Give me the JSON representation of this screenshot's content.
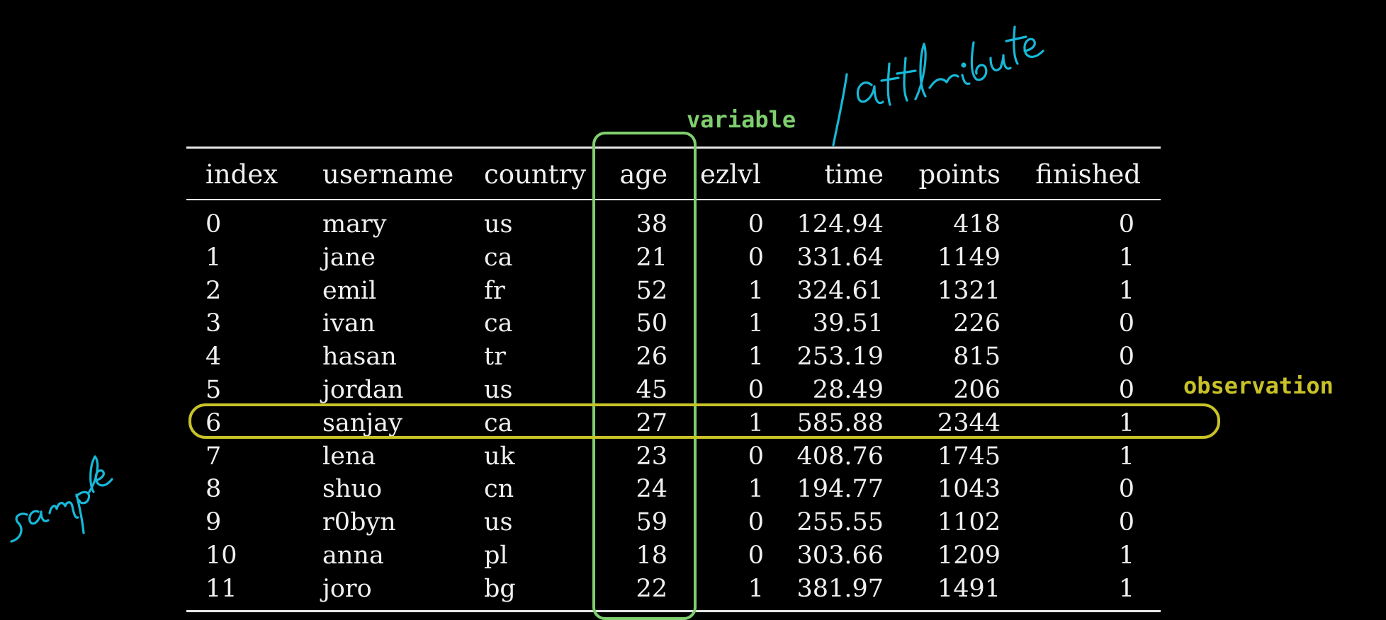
{
  "table": {
    "columns": [
      "index",
      "username",
      "country",
      "age",
      "ezlvl",
      "time",
      "points",
      "finished"
    ],
    "rows": [
      [
        "0",
        "mary",
        "us",
        "38",
        "0",
        "124.94",
        "418",
        "0"
      ],
      [
        "1",
        "jane",
        "ca",
        "21",
        "0",
        "331.64",
        "1149",
        "1"
      ],
      [
        "2",
        "emil",
        "fr",
        "52",
        "1",
        "324.61",
        "1321",
        "1"
      ],
      [
        "3",
        "ivan",
        "ca",
        "50",
        "1",
        "39.51",
        "226",
        "0"
      ],
      [
        "4",
        "hasan",
        "tr",
        "26",
        "1",
        "253.19",
        "815",
        "0"
      ],
      [
        "5",
        "jordan",
        "us",
        "45",
        "0",
        "28.49",
        "206",
        "0"
      ],
      [
        "6",
        "sanjay",
        "ca",
        "27",
        "1",
        "585.88",
        "2344",
        "1"
      ],
      [
        "7",
        "lena",
        "uk",
        "23",
        "0",
        "408.76",
        "1745",
        "1"
      ],
      [
        "8",
        "shuo",
        "cn",
        "24",
        "1",
        "194.77",
        "1043",
        "0"
      ],
      [
        "9",
        "r0byn",
        "us",
        "59",
        "0",
        "255.55",
        "1102",
        "0"
      ],
      [
        "10",
        "anna",
        "pl",
        "18",
        "0",
        "303.66",
        "1209",
        "1"
      ],
      [
        "11",
        "joro",
        "bg",
        "22",
        "1",
        "381.97",
        "1491",
        "1"
      ]
    ]
  },
  "annotations": {
    "variable_label": "variable",
    "observation_label": "observation",
    "handwritten_attribute": "attribute",
    "handwritten_sample": "sample",
    "highlighted_column": "age",
    "highlighted_row_index": "6"
  },
  "colors": {
    "background": "#000000",
    "text": "#f0f0f0",
    "variable_green": "#7fcf6f",
    "observation_yellow": "#c8c228",
    "handwriting_blue": "#17b8d8"
  }
}
